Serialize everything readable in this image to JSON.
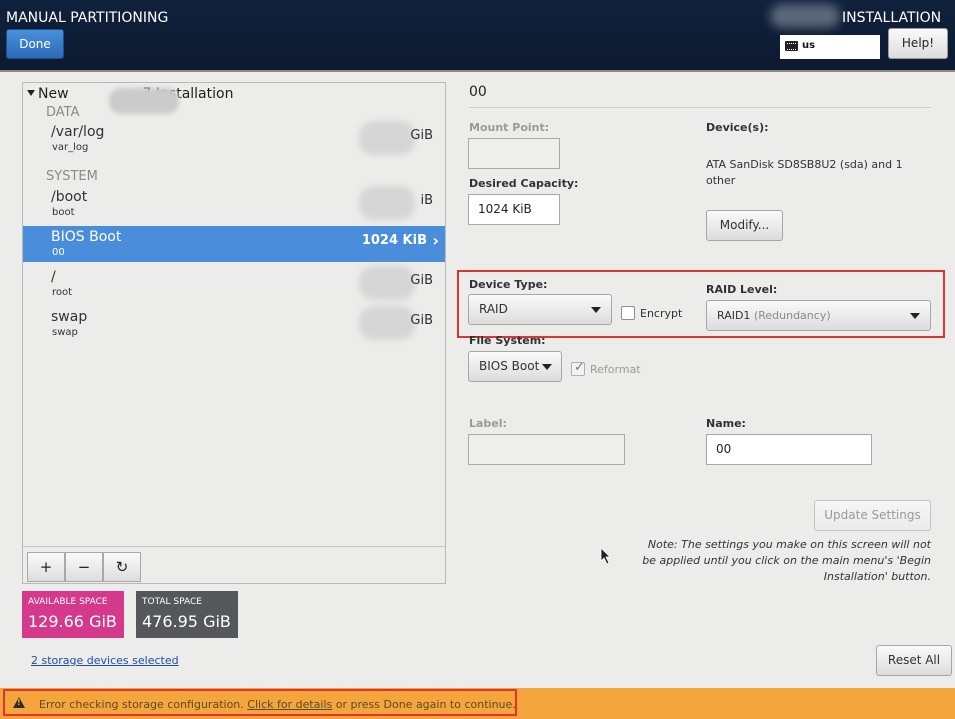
{
  "header": {
    "title": "MANUAL PARTITIONING",
    "done_label": "Done",
    "installation_label": "INSTALLATION",
    "keyboard_layout": "us",
    "help_label": "Help!"
  },
  "tree": {
    "root_label_prefix": "New",
    "root_label_suffix": "7 Installation",
    "groups": [
      {
        "label": "DATA"
      },
      {
        "label": "SYSTEM"
      }
    ],
    "partitions": [
      {
        "name": "/var/log",
        "device": "var_log",
        "size_suffix": "GiB"
      },
      {
        "name": "/boot",
        "device": "boot",
        "size_suffix": "iB"
      },
      {
        "name": "BIOS Boot",
        "device": "00",
        "size": "1024 KiB"
      },
      {
        "name": "/",
        "device": "root",
        "size_suffix": "GiB"
      },
      {
        "name": "swap",
        "device": "swap",
        "size_suffix": "GiB"
      }
    ],
    "toolbar": {
      "add": "+",
      "remove": "−",
      "refresh": "↻"
    }
  },
  "space": {
    "available_label": "AVAILABLE SPACE",
    "available_value": "129.66 GiB",
    "total_label": "TOTAL SPACE",
    "total_value": "476.95 GiB"
  },
  "storage_link": "2 storage devices selected",
  "details": {
    "title": "00",
    "mount_point_label": "Mount Point:",
    "mount_point_value": "",
    "desired_capacity_label": "Desired Capacity:",
    "desired_capacity_value": "1024 KiB",
    "devices_label": "Device(s):",
    "devices_value": "ATA SanDisk SD8SB8U2 (sda) and 1 other",
    "modify_label": "Modify...",
    "device_type_label": "Device Type:",
    "device_type_value": "RAID",
    "encrypt_label": "Encrypt",
    "raid_level_label": "RAID Level:",
    "raid_level_value": "RAID1",
    "raid_level_hint": "(Redundancy)",
    "file_system_label": "File System:",
    "file_system_value": "BIOS Boot",
    "reformat_label": "Reformat",
    "label_label": "Label:",
    "label_value": "",
    "name_label": "Name:",
    "name_value": "00",
    "update_label": "Update Settings",
    "note": "Note:  The settings you make on this screen will not be applied until you click on the main menu's 'Begin Installation' button.",
    "reset_label": "Reset All"
  },
  "error": {
    "text_before": "Error checking storage configuration.",
    "link": "Click for details",
    "text_after": "or press Done again to continue."
  },
  "colors": {
    "header_bg": "#0f1f3a",
    "selected": "#4a8edb",
    "available": "#d5398b",
    "total": "#55575a",
    "error_bar": "#f4a63d",
    "highlight": "#e03434"
  }
}
